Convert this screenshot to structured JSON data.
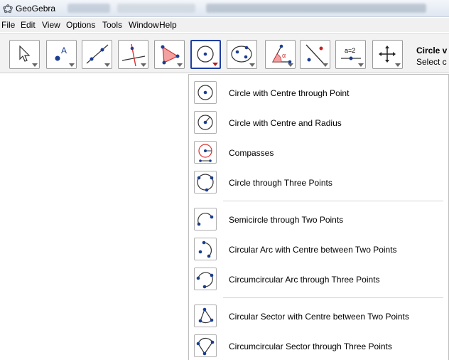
{
  "window": {
    "title": "GeoGebra"
  },
  "menubar": {
    "items": [
      "File",
      "Edit",
      "View",
      "Options",
      "Tools",
      "Window",
      "Help"
    ]
  },
  "toolbar": {
    "tools": [
      {
        "icon": "move-pointer-icon"
      },
      {
        "icon": "new-point-icon"
      },
      {
        "icon": "line-through-two-points-icon"
      },
      {
        "icon": "perpendicular-line-icon"
      },
      {
        "icon": "polygon-icon"
      },
      {
        "icon": "circle-with-centre-icon",
        "selected": true
      },
      {
        "icon": "ellipse-icon"
      },
      {
        "icon": "angle-icon"
      },
      {
        "icon": "reflect-about-line-icon"
      },
      {
        "icon": "slider-icon",
        "text": "a=2"
      },
      {
        "icon": "move-graphics-view-icon"
      }
    ],
    "help_title": "Circle v",
    "help_subtitle": "Select c"
  },
  "dropdown": {
    "items": [
      {
        "label": "Circle with Centre through Point",
        "icon": "circle-centre-point-icon"
      },
      {
        "label": "Circle with Centre and Radius",
        "icon": "circle-centre-radius-icon"
      },
      {
        "label": "Compasses",
        "icon": "compasses-icon"
      },
      {
        "label": "Circle through Three Points",
        "icon": "circle-three-points-icon"
      },
      {
        "label": "Semicircle through Two Points",
        "icon": "semicircle-icon"
      },
      {
        "label": "Circular Arc with Centre between Two Points",
        "icon": "circular-arc-icon"
      },
      {
        "label": "Circumcircular Arc through Three Points",
        "icon": "circumcircular-arc-icon"
      },
      {
        "label": "Circular Sector with Centre between Two Points",
        "icon": "circular-sector-icon"
      },
      {
        "label": "Circumcircular Sector through Three Points",
        "icon": "circumcircular-sector-icon"
      }
    ]
  },
  "colors": {
    "point_blue": "#1a3d8f",
    "selected_border": "#1f3fa0",
    "compass_red": "#e03030"
  }
}
